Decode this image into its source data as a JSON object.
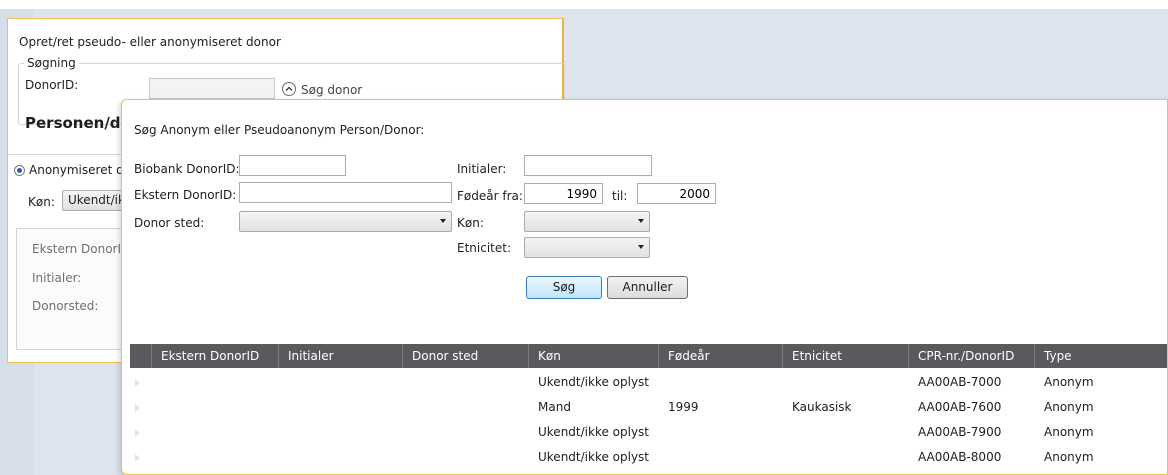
{
  "back_window": {
    "title": "Opret/ret pseudo- eller anonymiseret donor",
    "search_group": "Søgning",
    "donor_id_label": "DonorID:",
    "donor_id_value": "",
    "search_donor_label": "Søg donor",
    "section_title": "Personen/dor",
    "radio_label": "Anonymiseret do",
    "gender_label": "Køn:",
    "gender_value": "Ukendt/ik",
    "ext_donor_label": "Ekstern DonorID",
    "initials_label": "Initialer:",
    "donor_place_label": "Donorsted:"
  },
  "dialog": {
    "title": "Søg Anonym eller Pseudoanonym Person/Donor:",
    "biobank_label": "Biobank DonorID:",
    "biobank_value": "",
    "ext_label": "Ekstern DonorID:",
    "ext_value": "",
    "place_label": "Donor sted:",
    "place_value": "",
    "initials_label": "Initialer:",
    "initials_value": "",
    "birth_from_label": "Fødeår fra:",
    "birth_from_value": "1990",
    "birth_to_label": "til:",
    "birth_to_value": "2000",
    "gender_label": "Køn:",
    "gender_value": "",
    "ethnicity_label": "Etnicitet:",
    "ethnicity_value": "",
    "search_button": "Søg",
    "cancel_button": "Annuller"
  },
  "grid": {
    "columns": [
      "Ekstern DonorID",
      "Initialer",
      "Donor sted",
      "Køn",
      "Fødeår",
      "Etnicitet",
      "CPR-nr./DonorID",
      "Type"
    ],
    "rows": [
      [
        "",
        "",
        "",
        "Ukendt/ikke oplyst",
        "",
        "",
        "AA00AB-7000",
        "Anonym"
      ],
      [
        "",
        "",
        "",
        "Mand",
        "1999",
        "Kaukasisk",
        "AA00AB-7600",
        "Anonym"
      ],
      [
        "",
        "",
        "",
        "Ukendt/ikke oplyst",
        "",
        "",
        "AA00AB-7900",
        "Anonym"
      ],
      [
        "",
        "",
        "",
        "Ukendt/ikke oplyst",
        "",
        "",
        "AA00AB-8000",
        "Anonym"
      ]
    ]
  },
  "colors": {
    "window_border": "#f0c150",
    "grid_header": "#585a5e",
    "desktop": "#d5dee9"
  }
}
